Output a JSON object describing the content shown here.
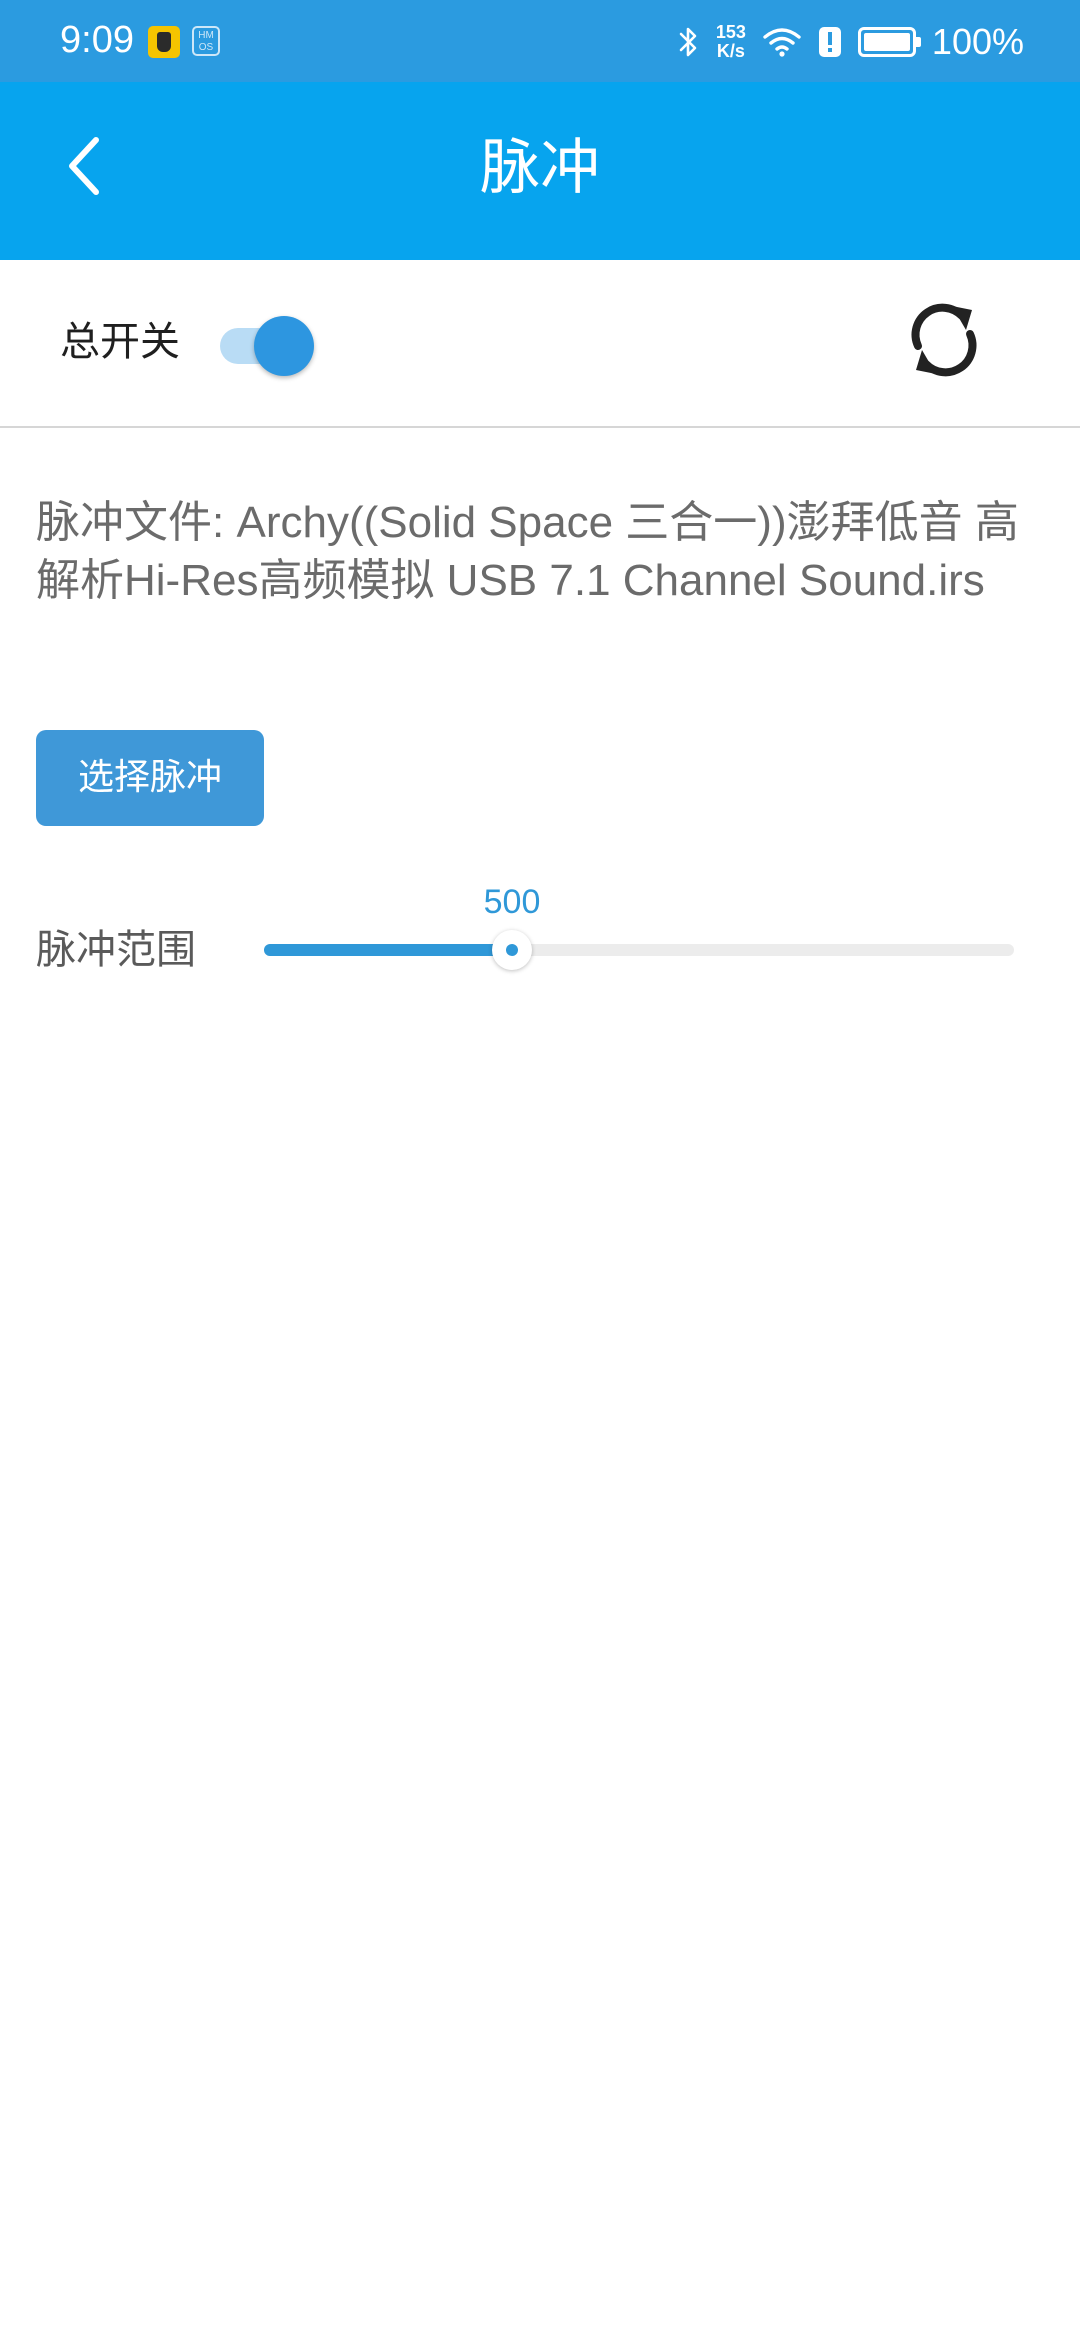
{
  "status_bar": {
    "time": "9:09",
    "hmos_badge": "HM OS",
    "net_speed_value": "153",
    "net_speed_unit": "K/s",
    "battery_percent": "100%",
    "icons": [
      "app-notification-icon",
      "hmos-icon",
      "bluetooth-icon",
      "wifi-icon",
      "alert-icon",
      "battery-charging-icon"
    ]
  },
  "header": {
    "title": "脉冲",
    "back_icon": "chevron-left-icon",
    "background": "#07a4ee"
  },
  "master_switch": {
    "label": "总开关",
    "on": true,
    "refresh_icon": "refresh-icon"
  },
  "impulse": {
    "file_label": "脉冲文件:",
    "file_name": "Archy((Solid Space 三合一))澎拜低音 高解析Hi-Res高频模拟 USB 7.1 Channel Sound.irs",
    "select_button_label": "选择脉冲"
  },
  "impulse_range": {
    "label": "脉冲范围",
    "value": 500,
    "value_text": "500",
    "position_fraction": 0.33
  },
  "colors": {
    "status_bar": "#2b9be0",
    "header": "#07a4ee",
    "accent": "#2f98d8",
    "button": "#3f98d8"
  }
}
